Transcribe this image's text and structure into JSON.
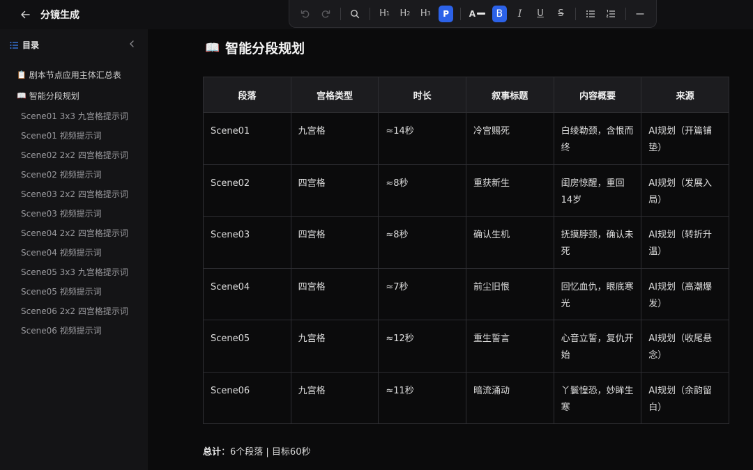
{
  "app": {
    "title": "分镜生成"
  },
  "toolbar": {
    "undo_icon": "undo-icon",
    "redo_icon": "redo-icon",
    "search_icon": "search-icon",
    "h1": "H",
    "h2": "H",
    "h3": "H",
    "h1_sub": "1",
    "h2_sub": "2",
    "h3_sub": "3",
    "paragraph": "P",
    "text_color": "A",
    "bold": "B",
    "italic": "I",
    "underline": "U",
    "strike": "S",
    "accent": "#2c62e8"
  },
  "sidebar": {
    "toc_label": "目录",
    "items": [
      {
        "icon": "📋",
        "label": "剧本节点应用主体汇总表"
      },
      {
        "icon": "📖",
        "label": "智能分段规划"
      }
    ],
    "sub_items": [
      "Scene01 3x3 九宫格提示词",
      "Scene01 视频提示词",
      "Scene02 2x2 四宫格提示词",
      "Scene02 视频提示词",
      "Scene03 2x2 四宫格提示词",
      "Scene03 视频提示词",
      "Scene04 2x2 四宫格提示词",
      "Scene04 视频提示词",
      "Scene05 3x3 九宫格提示词",
      "Scene05 视频提示词",
      "Scene06 2x2 四宫格提示词",
      "Scene06 视频提示词"
    ]
  },
  "main": {
    "title_icon": "📖",
    "title": "智能分段规划",
    "table": {
      "headers": [
        "段落",
        "宫格类型",
        "时长",
        "叙事标题",
        "内容概要",
        "来源"
      ],
      "rows": [
        [
          "Scene01",
          "九宫格",
          "≈14秒",
          "冷宫赐死",
          "白绫勒颈，含恨而终",
          "AI规划（开篇铺垫）"
        ],
        [
          "Scene02",
          "四宫格",
          "≈8秒",
          "重获新生",
          "闺房惊醒，重回14岁",
          "AI规划（发展入局）"
        ],
        [
          "Scene03",
          "四宫格",
          "≈8秒",
          "确认生机",
          "抚摸脖颈，确认未死",
          "AI规划（转折升温）"
        ],
        [
          "Scene04",
          "四宫格",
          "≈7秒",
          "前尘旧恨",
          "回忆血仇，眼底寒光",
          "AI规划（高潮爆发）"
        ],
        [
          "Scene05",
          "九宫格",
          "≈12秒",
          "重生誓言",
          "心音立誓，复仇开始",
          "AI规划（收尾悬念）"
        ],
        [
          "Scene06",
          "九宫格",
          "≈11秒",
          "暗流涌动",
          "丫鬟惶恐，妙眸生寒",
          "AI规划（余韵留白）"
        ]
      ]
    },
    "total_label": "总计",
    "total_value": "：6个段落 | 目标60秒"
  }
}
